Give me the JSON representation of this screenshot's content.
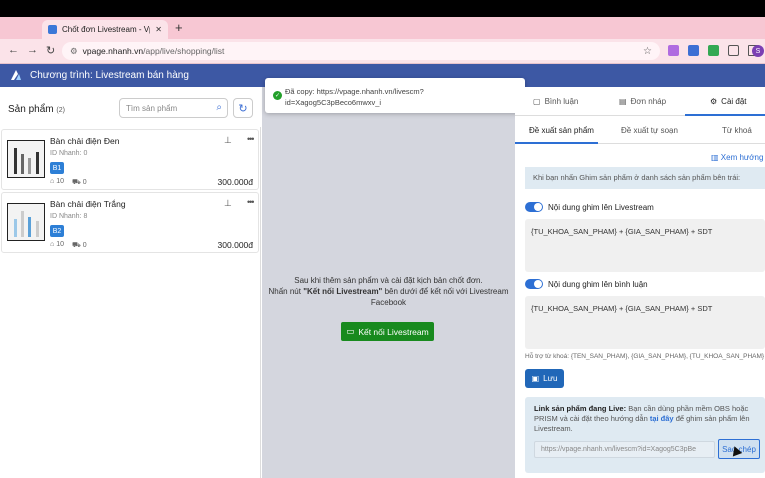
{
  "browser": {
    "tab_title": "Chốt đơn Livestream - Vpage",
    "tab_close": "✕",
    "new_tab": "+",
    "url_host": "vpage.nhanh.vn",
    "url_path": "/app/live/shopping/list",
    "avatar_letter": "S"
  },
  "app": {
    "title": "Chương trình: Livestream bán hàng"
  },
  "left": {
    "title": "Sản phẩm",
    "count": "(2)",
    "search_placeholder": "Tìm sản phẩm",
    "products": [
      {
        "name": "Bàn chải điện Đen",
        "id_label": "ID Nhanh: 0",
        "badge": "B1",
        "views": "10",
        "carts": "0",
        "price": "300.000đ"
      },
      {
        "name": "Bàn chải điện Trắng",
        "id_label": "ID Nhanh: 8",
        "badge": "B2",
        "views": "10",
        "carts": "0",
        "price": "300.000đ"
      }
    ]
  },
  "center": {
    "message_line1": "Sau khi thêm sản phẩm và cài đặt kịch bản chốt đơn.",
    "message_line2_pre": "Nhấn nút ",
    "message_line2_bold": "\"Kết nối Livestream\"",
    "message_line2_post": " bên dưới để kết nối với Livestream",
    "message_line3": "Facebook",
    "connect_button": "Kết nối Livestream"
  },
  "toast": {
    "text": "Đã copy: https://vpage.nhanh.vn/livescm?id=Xagog5C3pBeco6mwxv_i"
  },
  "right": {
    "tabs": [
      "Bình luận",
      "Đơn nháp",
      "Cài đặt"
    ],
    "subtabs": [
      "Đề xuất sản phẩm",
      "Đề xuất tự soạn",
      "Từ khoá"
    ],
    "guide_link": "Xem hướng",
    "hint": "Khi bạn nhấn Ghim sản phẩm ở danh sách sản phẩm bên trái:",
    "toggle1_label": "Nội dung ghim lên Livestream",
    "toggle1_value": "{TU_KHOA_SAN_PHAM} + {GIA_SAN_PHAM} + SDT",
    "toggle2_label": "Nội dung ghim lên bình luận",
    "toggle2_value": "{TU_KHOA_SAN_PHAM} + {GIA_SAN_PHAM} + SDT",
    "supports": "Hỗ trợ từ khoá: {TEN_SAN_PHAM}, {GIA_SAN_PHAM}, {TU_KHOA_SAN_PHAM}",
    "save_button": "Lưu",
    "link_title": "Link sản phẩm đang Live:",
    "link_desc_pre": " Bạn cần dùng phần mềm OBS hoặc PRISM và cài đặt theo hướng dẫn ",
    "link_desc_hl": "tại đây",
    "link_desc_post": " để ghim sản phẩm lên Livestream.",
    "link_value": "https://vpage.nhanh.vn/livescm?id=Xagog5C3pBe",
    "copy_button": "Sao chép"
  },
  "colors": {
    "header": "#3d58a4",
    "primary": "#2d6fd4",
    "connect": "#188a1e"
  }
}
